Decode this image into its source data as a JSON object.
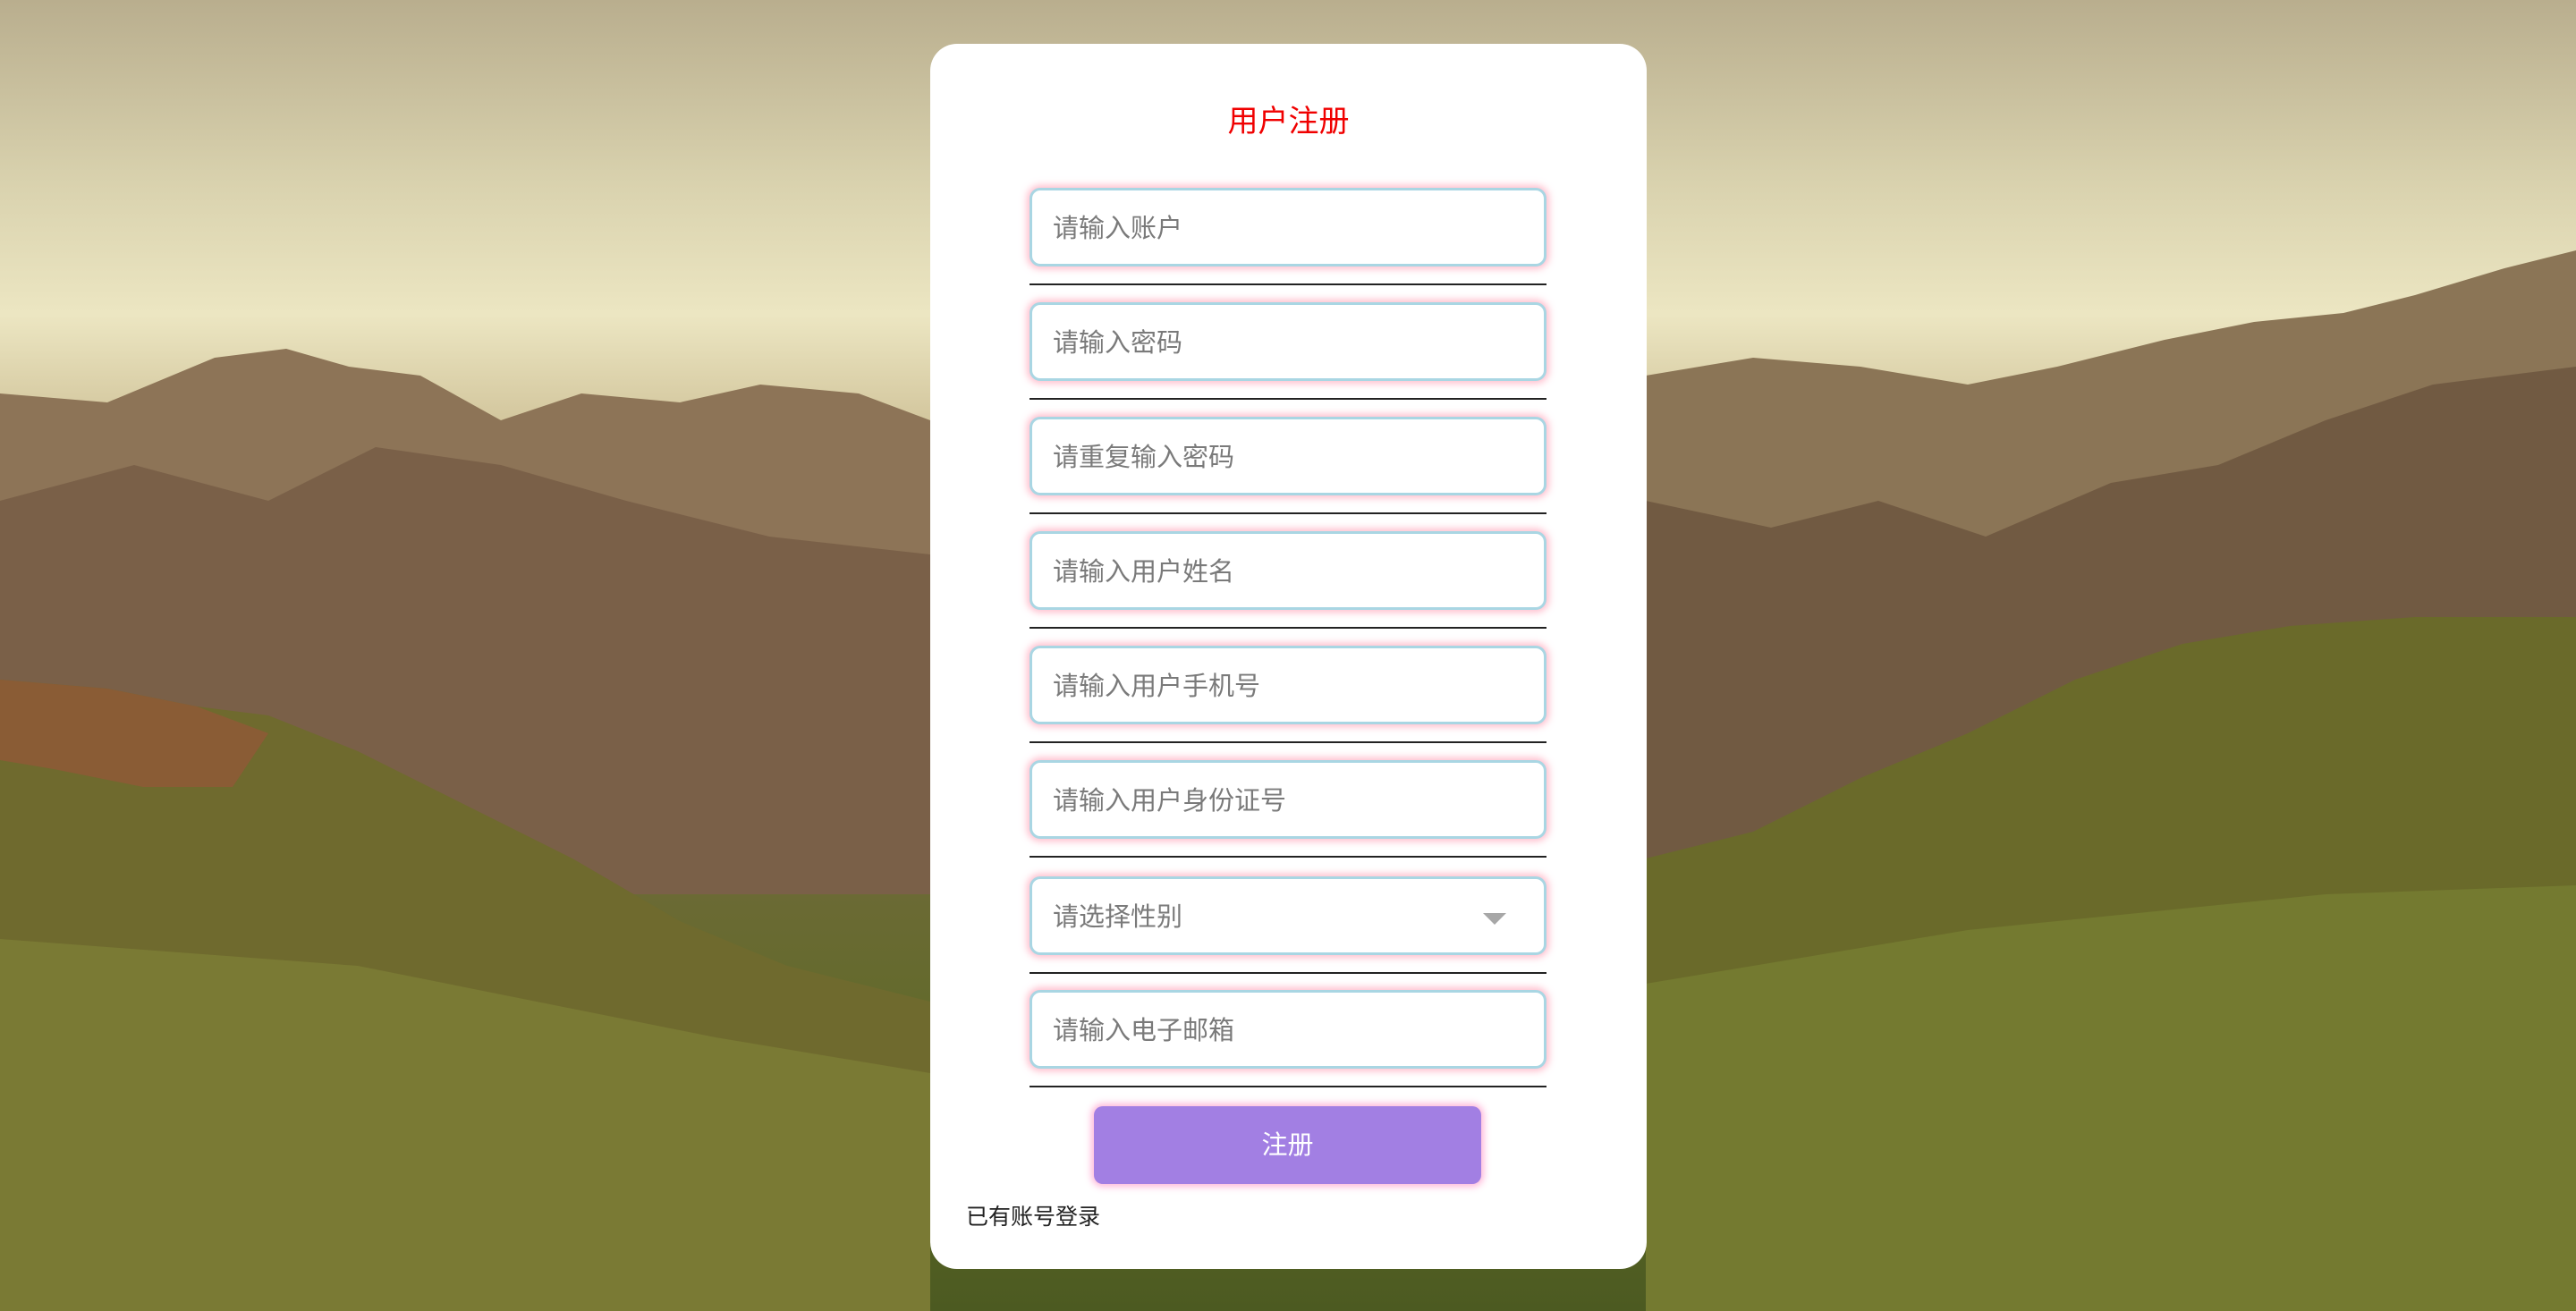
{
  "form": {
    "title": "用户注册",
    "fields": [
      {
        "placeholder": "请输入账户"
      },
      {
        "placeholder": "请输入密码"
      },
      {
        "placeholder": "请重复输入密码"
      },
      {
        "placeholder": "请输入用户姓名"
      },
      {
        "placeholder": "请输入用户手机号"
      },
      {
        "placeholder": "请输入用户身份证号"
      },
      {
        "placeholder": "请选择性别"
      },
      {
        "placeholder": "请输入电子邮箱"
      }
    ],
    "submit_label": "注册",
    "login_link": "已有账号登录"
  },
  "icons": {
    "gender_dropdown": "chevron-down-icon"
  },
  "colors": {
    "title": "#f00000",
    "button": "#a27fe3",
    "input_border": "#a9d6e3",
    "input_glow": "#ffaabe"
  }
}
